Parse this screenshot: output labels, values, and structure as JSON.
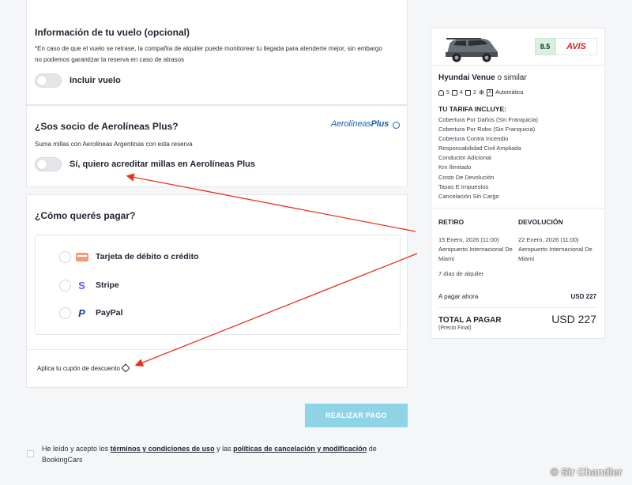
{
  "flight": {
    "title": "Información de tu vuelo (opcional)",
    "note_line1": "*En caso de que el vuelo se retrase, la compañía de alquiler puede monitorear tu llegada para atenderte mejor, sin embargo",
    "note_line2": "no podemos garantizar la reserva en caso de atrasos",
    "toggle_label": "Incluir vuelo",
    "toggle_on": false
  },
  "aerolineas": {
    "title": "¿Sos socio de Aerolíneas Plus?",
    "subtitle": "Suma millas con Aerolineas Argentinas con esta reserva",
    "logo_text": "Aerolíneas",
    "logo_plus": "Plus",
    "toggle_label": "Sí, quiero acreditar millas en Aerolíneas Plus",
    "toggle_on": false
  },
  "payment": {
    "title": "¿Cómo querés pagar?",
    "methods": [
      {
        "label": "Tarjeta de débito o crédito",
        "icon": "credit-card-icon"
      },
      {
        "label": "Stripe",
        "icon": "stripe-icon",
        "glyph": "S"
      },
      {
        "label": "PayPal",
        "icon": "paypal-icon",
        "glyph": "P"
      }
    ],
    "coupon_label": "Aplica tu cupón de descuento"
  },
  "pay_button": "REALIZAR PAGO",
  "terms": {
    "part1": "He leído y acepto los",
    "link1": "términos y condiciones de uso",
    "part2": "y las",
    "link2": "políticas de cancelación y modificación",
    "part3": "de BookingCars"
  },
  "watermark": "© Sir Chandler",
  "summary": {
    "score": "8.5",
    "brand": "AVIS",
    "car_name": "Hyundai Venue",
    "car_similar": "o similar",
    "specs": {
      "seats": "5",
      "doors": "4",
      "bags": "2",
      "transmission": "Automática"
    },
    "includes_title": "TU TARIFA INCLUYE:",
    "includes": [
      "Cobertura Por Daños (Sin Franquicia)",
      "Cobertura Por Robo (Sin Franquicia)",
      "Cobertura Contra Incendio",
      "Responsabilidad Civil Ampliada",
      "Conductor Adicional",
      "Km Ilimitado",
      "Costo De Devolución",
      "Tasas E Impuestos",
      "Cancelación Sin Cargo"
    ],
    "pickup_head": "RETIRO",
    "pickup_date": "15 Enero, 2026 (11:00)",
    "pickup_place": "Aeropuerto Internacional De Miami",
    "return_head": "DEVOLUCIÓN",
    "return_date": "22 Enero, 2026 (11:00)",
    "return_place": "Aeropuerto Internacional De Miami",
    "days": "7 días de alquiler",
    "pay_now_label": "A pagar ahora",
    "pay_now_value": "USD 227",
    "total_label": "TOTAL A PAGAR",
    "total_sub": "(Precio Final)",
    "total_value": "USD 227"
  },
  "colors": {
    "accent_button": "#8fd3e6",
    "brand_red": "#d2232a",
    "annotation_arrow": "#e8321c",
    "score_bg": "#d8f0de"
  }
}
